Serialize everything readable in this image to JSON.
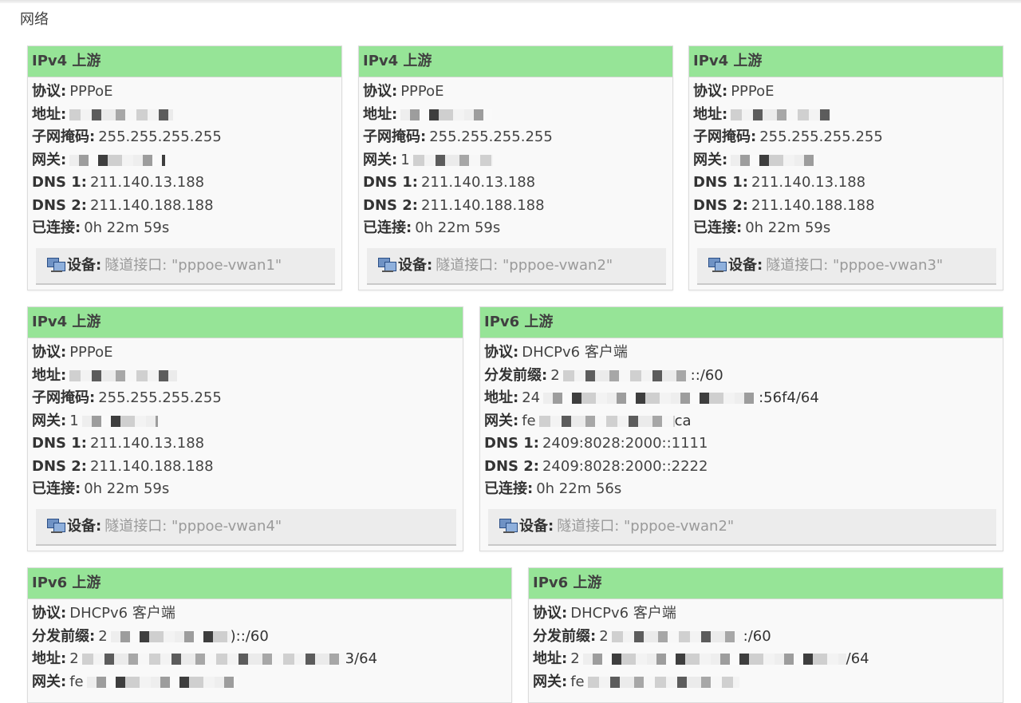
{
  "section_title": "网络",
  "labels": {
    "protocol": "协议:",
    "address": "地址:",
    "netmask": "子网掩码:",
    "gateway": "网关:",
    "dns1": "DNS 1:",
    "dns2": "DNS 2:",
    "connected": "已连接:",
    "prefix": "分发前缀:",
    "device": "设备:"
  },
  "cards": [
    {
      "title": "IPv4 上游",
      "protocol": "PPPoE",
      "address": "",
      "netmask": "255.255.255.255",
      "gateway": "",
      "dns1": "211.140.13.188",
      "dns2": "211.140.188.188",
      "connected": "0h 22m 59s",
      "device": "隧道接口: \"pppoe-vwan1\""
    },
    {
      "title": "IPv4 上游",
      "protocol": "PPPoE",
      "address": "",
      "netmask": "255.255.255.255",
      "gateway": "1",
      "dns1": "211.140.13.188",
      "dns2": "211.140.188.188",
      "connected": "0h 22m 59s",
      "device": "隧道接口: \"pppoe-vwan2\""
    },
    {
      "title": "IPv4 上游",
      "protocol": "PPPoE",
      "address": "",
      "netmask": "255.255.255.255",
      "gateway": "",
      "dns1": "211.140.13.188",
      "dns2": "211.140.188.188",
      "connected": "0h 22m 59s",
      "device": "隧道接口: \"pppoe-vwan3\""
    },
    {
      "title": "IPv4 上游",
      "protocol": "PPPoE",
      "address": "",
      "netmask": "255.255.255.255",
      "gateway": "1",
      "dns1": "211.140.13.188",
      "dns2": "211.140.188.188",
      "connected": "0h 22m 59s",
      "device": "隧道接口: \"pppoe-vwan4\""
    },
    {
      "title": "IPv6 上游",
      "protocol": "DHCPv6 客户端",
      "prefix_head": "2",
      "prefix_tail": "::/60",
      "address_head": "24",
      "address_tail": ":56f4/64",
      "gateway_head": "fe",
      "gateway_tail": "ca",
      "dns1": "2409:8028:2000::1111",
      "dns2": "2409:8028:2000::2222",
      "connected": "0h 22m 56s",
      "device": "隧道接口: \"pppoe-vwan2\""
    },
    {
      "title": "IPv6 上游",
      "protocol": "DHCPv6 客户端",
      "prefix_head": "2",
      "prefix_tail": ")::/60",
      "address_head": "2",
      "address_tail": "3/64",
      "gateway_head": "fe"
    },
    {
      "title": "IPv6 上游",
      "protocol": "DHCPv6 客户端",
      "prefix_head": "2",
      "prefix_tail": ":/60",
      "address_head": "2",
      "address_tail": "/64",
      "gateway_head": "fe"
    }
  ],
  "colors": {
    "card_header": "#96e497",
    "card_bg": "#f9f9f9",
    "device_bar": "#ececec"
  },
  "icons": {
    "device": "network-device-icon"
  }
}
